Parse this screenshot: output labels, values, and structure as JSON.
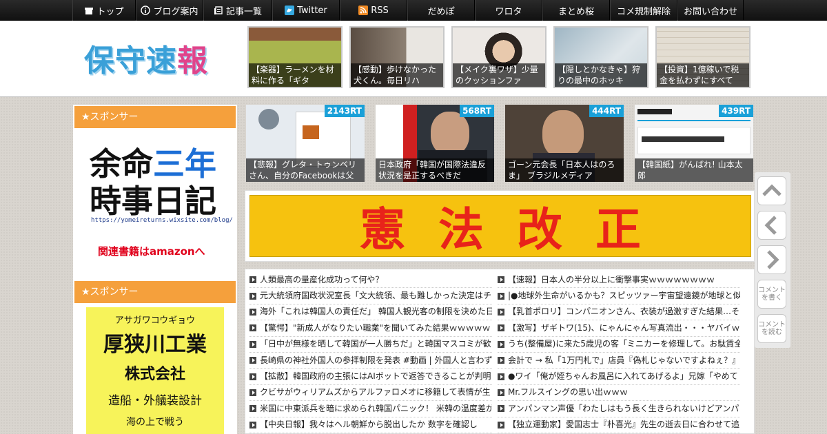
{
  "nav": {
    "items": [
      {
        "label": "トップ",
        "icon": "home-icon"
      },
      {
        "label": "ブログ案内",
        "icon": "info-icon"
      },
      {
        "label": "記事一覧",
        "icon": "list-icon"
      },
      {
        "label": "Twitter",
        "icon": "twitter-icon"
      },
      {
        "label": "RSS",
        "icon": "rss-icon"
      },
      {
        "label": "だめぽ"
      },
      {
        "label": "ワロタ"
      },
      {
        "label": "まとめ桜"
      },
      {
        "label": "コメ規制解除"
      },
      {
        "label": "お問い合わせ"
      }
    ]
  },
  "header": {
    "logo": {
      "c1": "保",
      "c2": "守",
      "c3": "速",
      "c4": "報"
    },
    "thumbs": [
      {
        "caption": "【楽器】ラーメンを材料に作る「ギタ",
        "color": "#9aa84a"
      },
      {
        "caption": "【感動】歩けなかった犬くん。毎日リハ",
        "color": "#7a6e60"
      },
      {
        "caption": "【メイク裏ワザ】少量のクッションファ",
        "color": "#e8e3dc"
      },
      {
        "caption": "【隠しとかなきゃ】狩りの最中のホッキ",
        "color": "#b9c8d2"
      },
      {
        "caption": "【投資】1億稼いで税金を払わずにすべて",
        "color": "#d8d1c4"
      }
    ]
  },
  "sidebar": {
    "sponsor1": "★スポンサー",
    "sponsor2": "★スポンサー",
    "ad1": {
      "line1a": "余命",
      "line1b": "三年",
      "line2": "時事日記",
      "url": "https://yomeireturns.wixsite.com/blog/",
      "amazon": "関連書籍はamazonへ"
    },
    "ad2": {
      "kana": "アサガワコウギョウ",
      "company": "厚狭川工業",
      "kk": "株式会社",
      "desc": "造船・外艤装設計",
      "bottom": "海の上で戦う"
    }
  },
  "rt": [
    {
      "badge": "2143RT",
      "caption": "【悲報】グレタ・トゥンベリさん、自分のFacebookは父",
      "color": "#dfe6ec"
    },
    {
      "badge": "568RT",
      "caption": "日本政府「韓国が国際法違反状況を是正するべきだ",
      "color": "#3a3f47"
    },
    {
      "badge": "444RT",
      "caption": "ゴーン元会長「日本人はのろま」 ブラジルメディア",
      "color": "#5b4a3e"
    },
    {
      "badge": "439RT",
      "caption": "【韓国紙】がんばれ! 山本太郎",
      "color": "#f2f2f2"
    }
  ],
  "banner": {
    "text": "憲法改正"
  },
  "list": {
    "left": [
      "人類最高の量産化成功って何や？",
      "元大統領府国政状況室長「文大統領、最も難しかった決定はチ",
      "海外「これは韓国人の責任だ」 韓国人観光客の制限を決めた日",
      "【驚愕】\"新成人がなりたい職業\"を聞いてみた結果ｗｗｗｗｗ",
      "「日中が無様を晒して韓国が一人勝ちだ」と韓国マスコミが歓",
      "長崎県の神社外国人の参拝制限を発表 #動画 | 外国人と言わず韓",
      "【拡散】韓国政府の主張にはAIボットで返答できることが判明",
      "クビサがウィリアムズからアルファロメオに移籍して表情が生",
      "米国に中東派兵を暗に求められ韓国パニック！ 米韓の温度差が",
      "【中央日報】我々はヘル朝鮮から脱出したか 数字を確認し"
    ],
    "right": [
      "【速報】日本人の半分以上に衝撃事実ｗｗｗｗｗｗｗｗ",
      "|●地球外生命がいるかも？スピッツァー宇宙望遠鏡が地球と似",
      "【乳首ポロリ】コンパニオンさん、衣装が過激すぎた結果…そ",
      "【激写】ザギトワ(15)、にゃんにゃん写真流出・・・ヤバイｗ",
      "うち(整備屋)に来た5歳児の客「ミニカーを修理して。お駄賃全",
      "会計で → 私「1万円札で」店員『偽札じゃないですよねぇ？』",
      "●ワイ「俺が姪ちゃんお風呂に入れてあげるよ」兄嫁「やめて",
      "Mr.フルスイングの思い出ｗｗｗ",
      "アンパンマン声優「わたしはもう長く生きられないけどアンパ",
      "【独立運動家】愛国志士『朴喜光』先生の逝去日に合わせて追"
    ]
  },
  "sidebuttons": {
    "comment_write": "コメントを書く",
    "comment_read": "コメントを読む"
  }
}
